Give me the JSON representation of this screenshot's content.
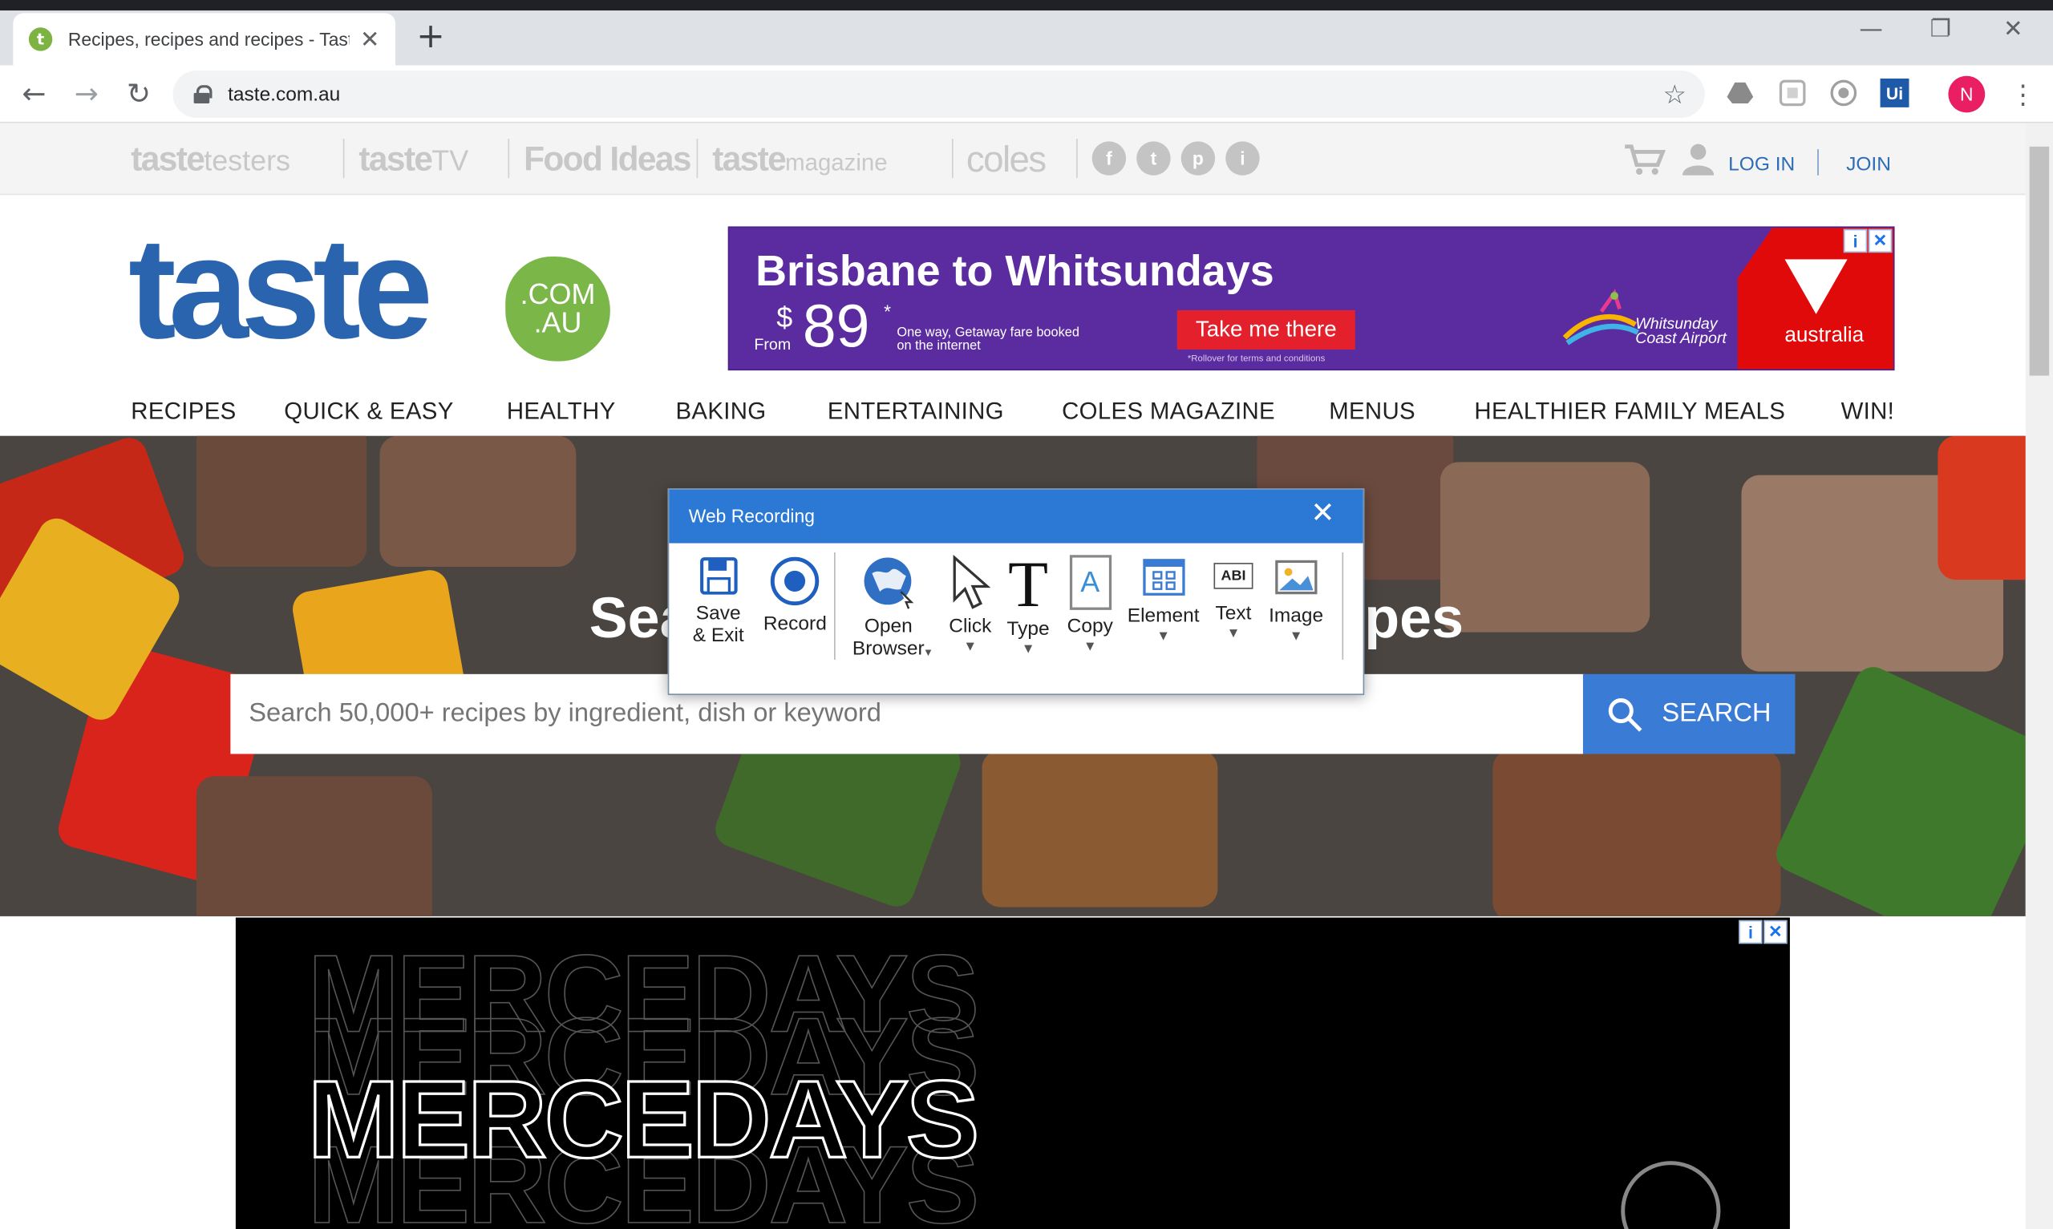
{
  "browser": {
    "tab_title": "Recipes, recipes and recipes - Taste",
    "tab_favicon_letter": "t",
    "new_tab_symbol": "+",
    "tab_close_symbol": "✕",
    "url": "taste.com.au",
    "profile_initial": "N",
    "extension_ui_label": "Ui",
    "window_controls": [
      "—",
      "❐",
      "✕"
    ]
  },
  "topstrip": {
    "brands": [
      {
        "main": "taste",
        "sub": "testers"
      },
      {
        "main": "taste",
        "sub": "TV"
      },
      {
        "main": "Food Ideas",
        "sub": ""
      },
      {
        "main": "taste",
        "sub": "magazine"
      },
      {
        "main": "coles",
        "sub": ""
      }
    ],
    "social": [
      "f",
      "t",
      "p",
      "i"
    ],
    "login": "LOG IN",
    "join": "JOIN"
  },
  "logo": {
    "word": "taste",
    "badge_top": ".COM",
    "badge_bottom": ".AU"
  },
  "ad_whitsundays": {
    "title": "Brisbane to Whitsundays",
    "from": "From",
    "currency": "$",
    "price": "89",
    "asterisk": "*",
    "fare_note": "One way, Getaway fare booked on the internet",
    "button": "Take me there",
    "terms": "*Rollover for terms and conditions",
    "airport": "Whitsunday Coast Airport",
    "airline": "australia",
    "adchoice": "i",
    "adclose": "✕"
  },
  "nav": [
    "RECIPES",
    "QUICK & EASY",
    "HEALTHY",
    "BAKING",
    "ENTERTAINING",
    "COLES MAGAZINE",
    "MENUS",
    "HEALTHIER FAMILY MEALS",
    "WIN!"
  ],
  "hero": {
    "title_left": "Sea",
    "title_right": "pes",
    "search_placeholder": "Search 50,000+ recipes by ingredient, dish or keyword",
    "search_button": "SEARCH"
  },
  "ad_mercedays": {
    "word": "MERCEDAYS",
    "adchoice": "i",
    "adclose": "✕"
  },
  "dialog": {
    "title": "Web Recording",
    "close": "✕",
    "tools": [
      {
        "label": "Save\n& Exit",
        "icon": "save-icon",
        "dropdown": false
      },
      {
        "label": "Record",
        "icon": "record-icon",
        "dropdown": false
      },
      {
        "label": "Open\nBrowser",
        "icon": "globe-icon",
        "dropdown": true
      },
      {
        "label": "Click",
        "icon": "cursor-icon",
        "dropdown": true
      },
      {
        "label": "Type",
        "icon": "type-icon",
        "dropdown": true
      },
      {
        "label": "Copy",
        "icon": "copy-icon",
        "dropdown": true
      },
      {
        "label": "Element",
        "icon": "element-icon",
        "dropdown": true
      },
      {
        "label": "Text",
        "icon": "text-icon",
        "dropdown": true
      },
      {
        "label": "Image",
        "icon": "image-icon",
        "dropdown": true
      }
    ],
    "type_glyph": "T",
    "copy_glyph": "A",
    "text_glyph": "ABI",
    "caret": "▼"
  },
  "colors": {
    "taste_blue": "#2b64ae",
    "taste_green": "#7ab648",
    "dialog_blue": "#2b79d4",
    "search_blue": "#3a7bd5",
    "ad_purple": "#5b2c9f"
  }
}
